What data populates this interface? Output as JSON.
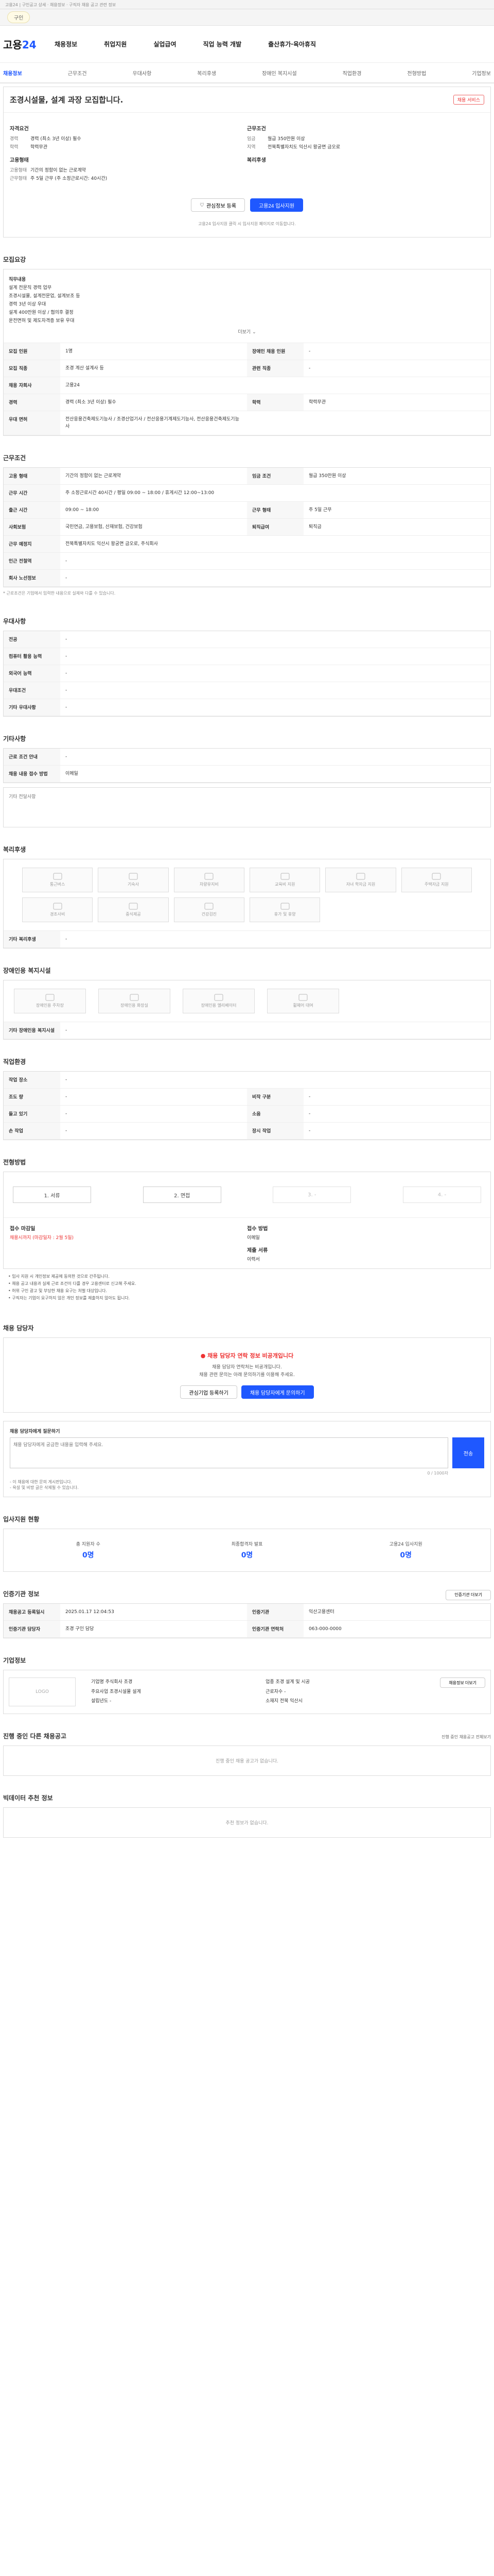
{
  "browser": {
    "top": "고용24 | 구인공고 상세 · 채용정보 · 구직자 채용 공고 관련 정보",
    "chip": "구인"
  },
  "header": {
    "logo_a": "고용",
    "logo_b": "24",
    "gnb": [
      "채용정보",
      "취업지원",
      "실업급여",
      "직업 능력 개발",
      "출산휴가·육아휴직"
    ]
  },
  "lnb": [
    "채용정보",
    "근무조건",
    "우대사항",
    "복리후생",
    "장애인 복지시설",
    "직업환경",
    "전형방법",
    "기업정보"
  ],
  "summary": {
    "title": "조경시설물, 설계 과장 모집합니다.",
    "badge": "채용 서비스",
    "left_head": "자격요건",
    "left": [
      [
        "경력",
        "경력 (최소 3년 이상) 필수"
      ],
      [
        "학력",
        "학력무관"
      ]
    ],
    "left_head2": "고용형태",
    "left2": [
      [
        "고용형태",
        "기간의 정함이 없는 근로계약"
      ],
      [
        "근무형태",
        "주 5일 근무 (주 소정근로시간: 40시간)"
      ]
    ],
    "right_head": "근무조건",
    "right": [
      [
        "임금",
        "월급 350만원 이상"
      ],
      [
        "지역",
        "전북특별자치도 익산시 왕궁면 금오로 "
      ]
    ],
    "right_head2": "복리후생",
    "btn_save": "관심정보 등록",
    "btn_apply": "고용24 입사지원",
    "note": "고용24 입사지원 클릭 시 입사지원 페이지로 이동합니다."
  },
  "recruit": {
    "title": "모집요강",
    "desc_head": "직무내용",
    "desc": [
      "설계 전문직 경력 업무",
      "조경시설물, 설계전문업, 설계보조 등",
      "경력 3년 이상 우대",
      "설계 400만원 이상 / 협의후 결정",
      "운전면허 및 제도자격증 보유 우대"
    ],
    "more": "더보기",
    "rows": [
      [
        [
          "모집 인원",
          "1명"
        ],
        [
          "장애인 채용 인원",
          "-"
        ]
      ],
      [
        [
          "모집 직종",
          "조경 계산 설계사 등"
        ],
        [
          "관련 직종",
          "-"
        ]
      ],
      [
        [
          "채용 자회사",
          "고용24"
        ],
        [
          "",
          ""
        ]
      ],
      [
        [
          "경력",
          "경력 (최소 3년 이상) 필수"
        ],
        [
          "학력",
          "학력무관"
        ]
      ],
      [
        [
          "우대 면허",
          "전산응용건축제도기능사 / 조경산업기사 / 전산응용기계제도기능사, 전산응용건축제도기능사"
        ],
        [
          "",
          ""
        ]
      ]
    ]
  },
  "work": {
    "title": "근무조건",
    "rows": [
      [
        [
          "고용 형태",
          "기간의 정함이 없는 근로계약"
        ],
        [
          "임금 조건",
          "월급 350만원 이상"
        ]
      ],
      [
        [
          "근무 시간",
          "주 소정근로시간 40시간 / 평일 09:00 ~ 18:00 / 휴게시간 12:00~13:00"
        ],
        [
          "",
          ""
        ]
      ],
      [
        [
          "출근 시간",
          "09:00 ~ 18:00"
        ],
        [
          "근무 형태",
          "주 5일 근무"
        ]
      ],
      [
        [
          "사회보험",
          "국민연금, 고용보험, 산재보험, 건강보험"
        ],
        [
          "퇴직급여",
          "퇴직금"
        ]
      ],
      [
        [
          "근무 예정지",
          "전북특별자치도 익산시 왕궁면 금오로, 주식회사 "
        ],
        [
          "",
          ""
        ]
      ],
      [
        [
          "인근 전철역",
          "-"
        ],
        [
          "",
          ""
        ]
      ],
      [
        [
          "회사 노선정보",
          "-"
        ],
        [
          "",
          ""
        ]
      ]
    ],
    "note": "* 근로조건은 기업에서 입력한 내용으로 실제와 다를 수 있습니다."
  },
  "pref": {
    "title": "우대사항",
    "rows": [
      [
        "전공",
        "-"
      ],
      [
        "컴퓨터 활용 능력",
        "-"
      ],
      [
        "외국어 능력",
        "-"
      ],
      [
        "우대조건",
        "-"
      ],
      [
        "기타 우대사항",
        "-"
      ]
    ]
  },
  "etc": {
    "title": "기타사항",
    "rows": [
      [
        "근로 조건 안내",
        "-"
      ],
      [
        "채용 내용 접수 방법",
        "이메일"
      ]
    ],
    "box": "기타 전달사항"
  },
  "welfare": {
    "title": "복리후생",
    "icons": [
      "통근버스",
      "기숙사",
      "차량유지비",
      "교육비 지원",
      "자녀 학자금 지원",
      "주택자금 지원",
      "경조사비",
      "중식제공",
      "건강검진",
      "휴가 및 휴양"
    ],
    "row_k": "기타 복리후생",
    "row_v": "-"
  },
  "facility": {
    "title": "장애인용 복지시설",
    "icons": [
      "장애인용 주차장",
      "장애인용 화장실",
      "장애인용 엘리베이터",
      "휠체어 대여"
    ],
    "row_k": "기타 장애인용 복지시설",
    "row_v": "-"
  },
  "env": {
    "title": "직업환경",
    "rows": [
      [
        [
          "작업 장소",
          "-"
        ],
        [
          "",
          ""
        ]
      ],
      [
        [
          "조도 량",
          "-"
        ],
        [
          "비작 구분",
          "-"
        ]
      ],
      [
        [
          "들고 있기",
          "-"
        ],
        [
          "소음",
          "-"
        ]
      ],
      [
        [
          "손 작업",
          "-"
        ],
        [
          "장시 작업",
          "-"
        ]
      ]
    ]
  },
  "select": {
    "title": "전형방법",
    "steps": [
      "서류",
      "면접",
      "-",
      "-"
    ],
    "apply_k": "접수 마감일",
    "apply_v": "채용시까지 (마감일자 : 2월 5일)",
    "way_k": "접수 방법",
    "way_v": "이메일",
    "doc_k": "제출 서류",
    "doc_v": "이력서",
    "warns": [
      "입사 지원 시 개인정보 제공에 동의한 것으로 간주됩니다.",
      "채용 공고 내용과 실제 근로 조건이 다를 경우 고용센터로 신고해 주세요.",
      "허위 구인 광고 및 부당한 채용 요구는 처벌 대상입니다.",
      "구직자는 기업이 요구하지 않은 개인 정보를 제출하지 않아도 됩니다."
    ]
  },
  "contact": {
    "title": "채용 담당자",
    "alert": "채용 담당자 연락 정보 비공개입니다",
    "sub1": "채용 담당자 연락처는 비공개입니다.",
    "sub2": "채용 관련 문의는 아래 문의하기를 이용해 주세요.",
    "btn1": "채용 담당자에게 문의하기",
    "btn2": "관심기업 등록하기"
  },
  "qa": {
    "label": "채용 담당자에게 질문하기",
    "placeholder": "채용 담당자에게 궁금한 내용을 입력해 주세요.",
    "count": "0 / 1000자",
    "send": "전송",
    "note1": "- 이 채용에 대한 문의 게시판입니다.",
    "note2": "- 욕설 및 비방 글은 삭제될 수 있습니다."
  },
  "applicants": {
    "title": "입사지원 현황",
    "items": [
      [
        "총 지원자 수",
        "0명"
      ],
      [
        "최종합격자 발표",
        "0명"
      ],
      [
        "고용24 입사지원",
        "0명"
      ]
    ]
  },
  "org": {
    "title": "인증기관 정보",
    "more": "인증기관 더보기",
    "rows": [
      [
        [
          "채용공고 등록일시",
          "2025.01.17 12:04:53"
        ],
        [
          "인증기관",
          "익산고용센터"
        ]
      ],
      [
        [
          "인증기관 담당자",
          "조경 구인 담당"
        ],
        [
          "인증기관 연락처",
          "063-000-0000"
        ]
      ]
    ]
  },
  "company": {
    "title": "기업정보",
    "logo": "LOGO",
    "btn": "채용정보 더보기",
    "rows": [
      [
        "기업명",
        "주식회사 조경"
      ],
      [
        "업종",
        "조경 설계 및 시공"
      ],
      [
        "주요사업",
        "조경시설물 설계"
      ],
      [
        "근로자수",
        "-"
      ],
      [
        "설립년도",
        "-"
      ],
      [
        "소재지",
        "전북 익산시"
      ]
    ]
  },
  "other": {
    "title": "진행 중인 다른 채용공고",
    "more": "진행 중인 채용공고 전체보기",
    "empty": "진행 중인 채용 공고가 없습니다."
  },
  "ai": {
    "title": "빅데이터 추천 정보",
    "empty": "추천 정보가 없습니다."
  }
}
